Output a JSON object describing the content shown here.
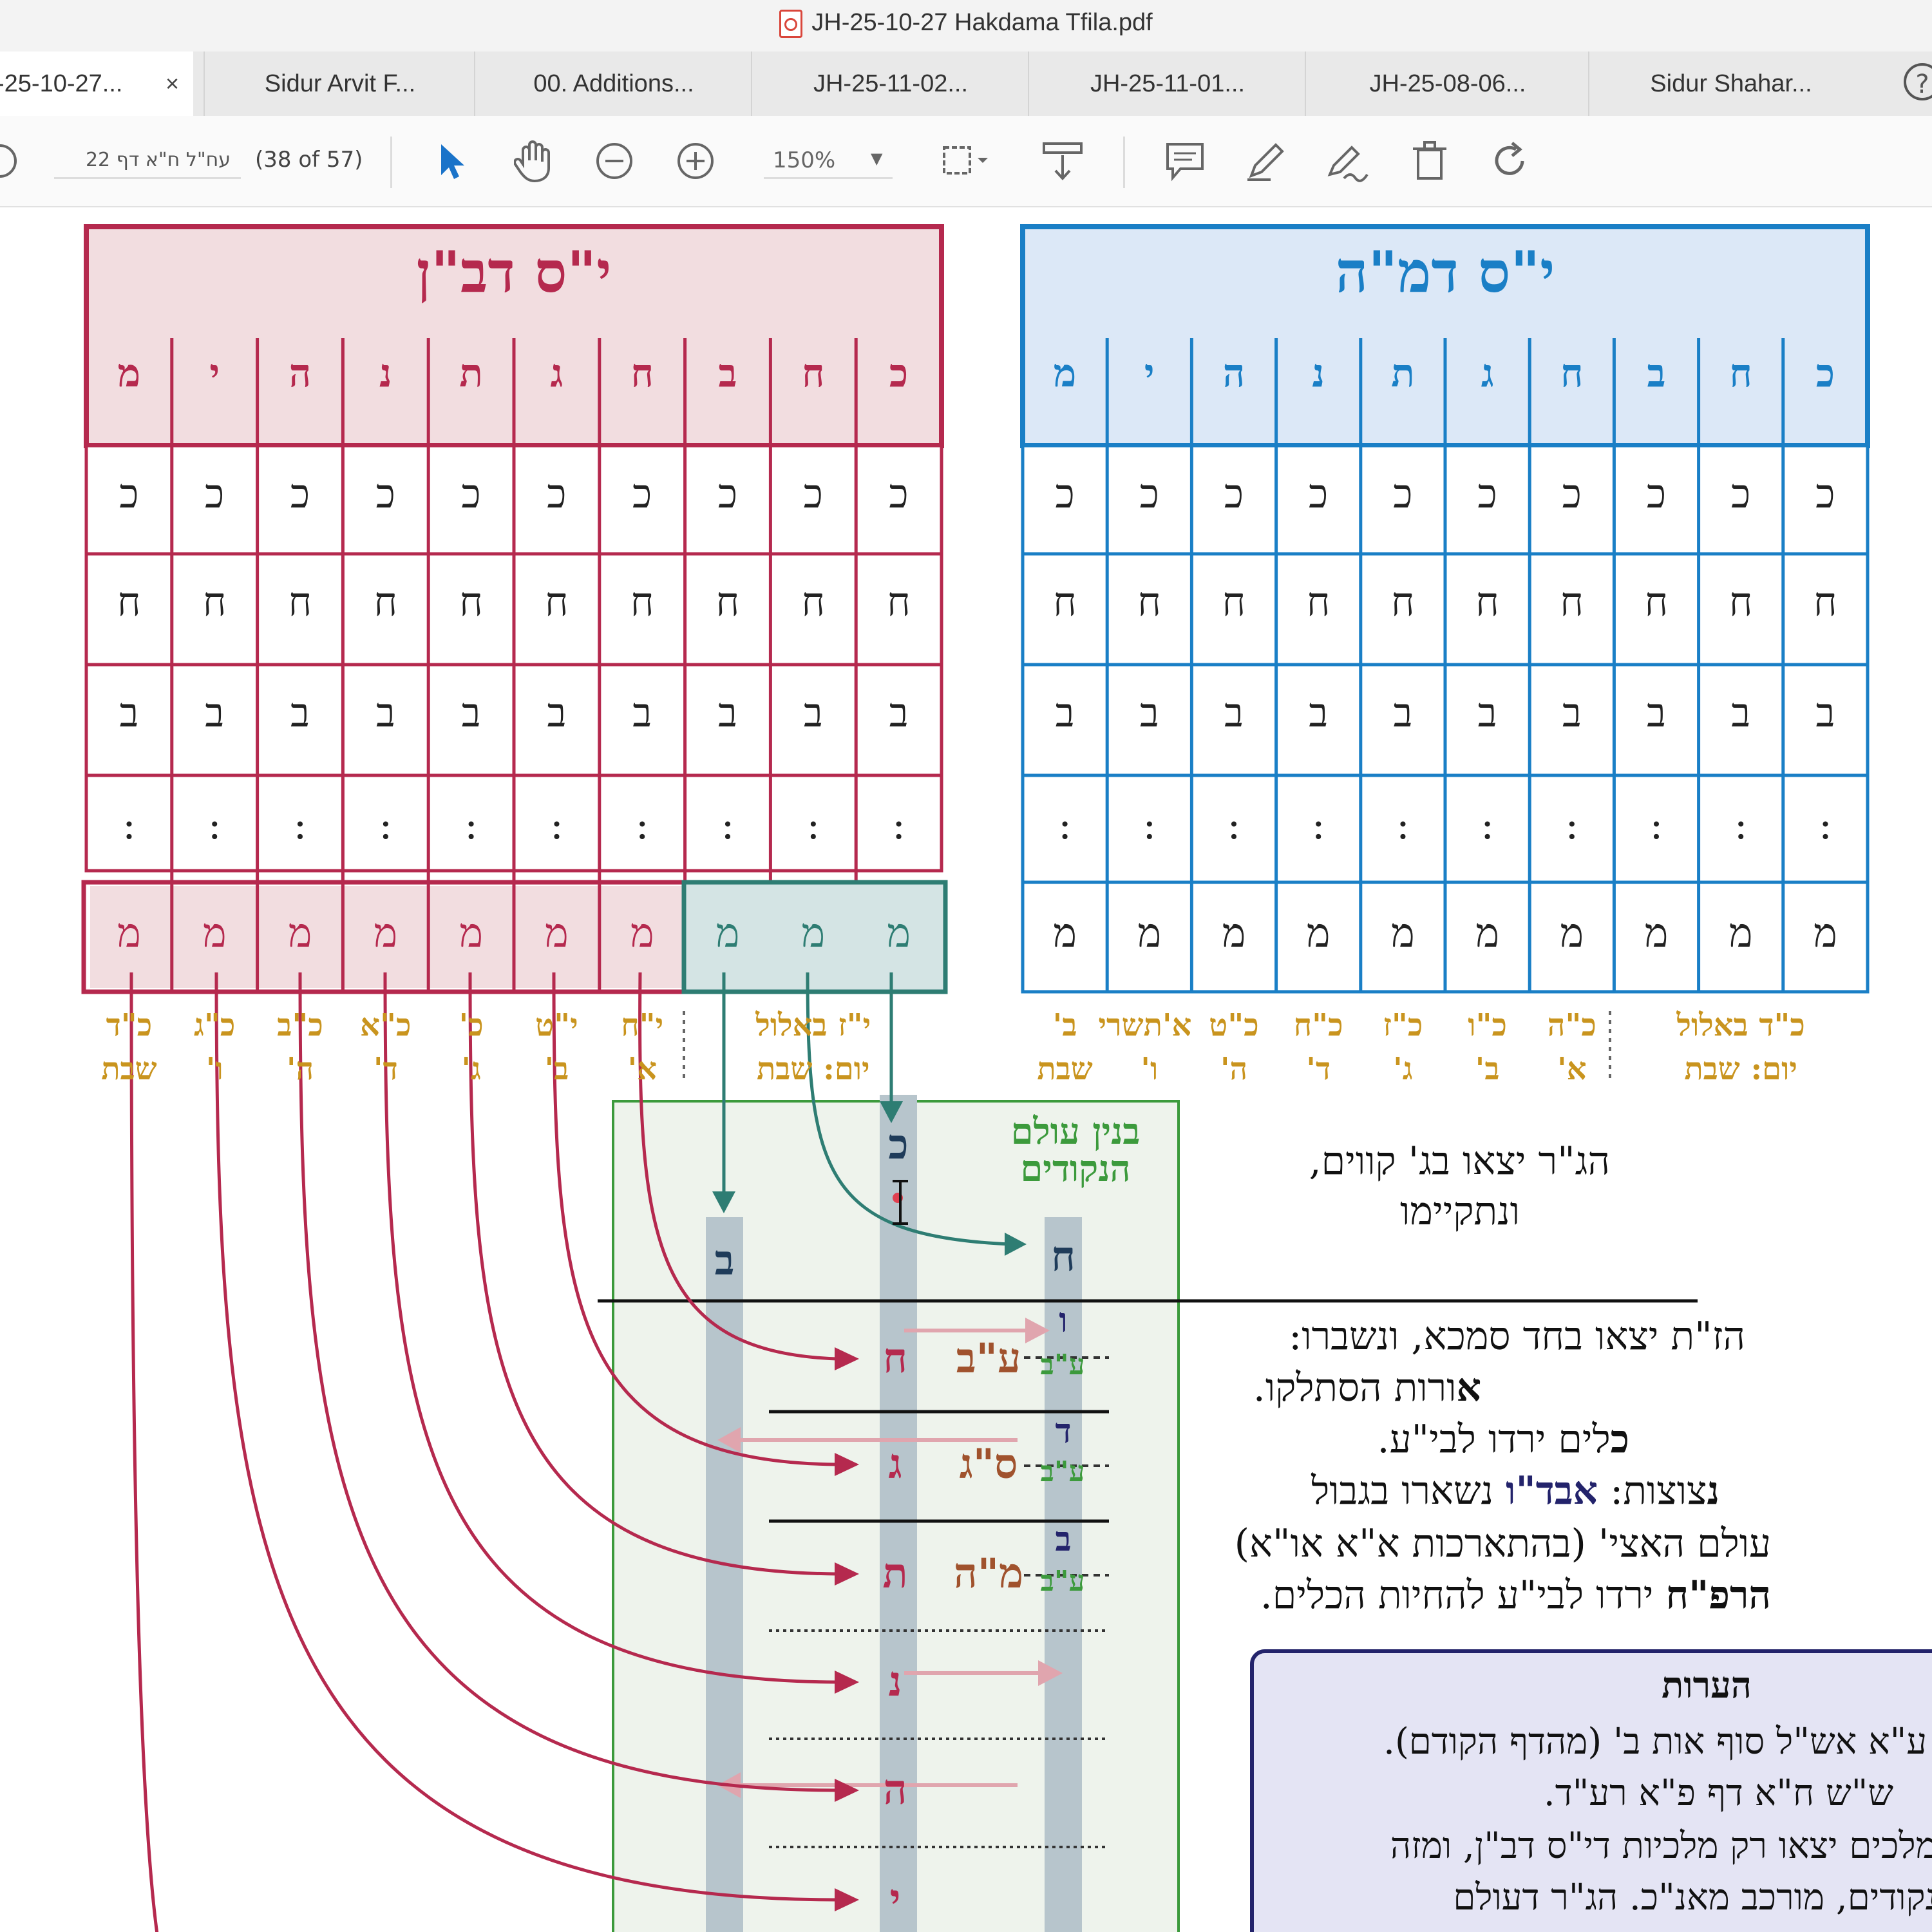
{
  "window": {
    "title": "JH-25-10-27 Hakdama Tfila.pdf"
  },
  "tabs": [
    {
      "label": "-25-10-27...",
      "close": "×"
    },
    {
      "label": "Sidur Arvit F..."
    },
    {
      "label": "00. Additions..."
    },
    {
      "label": "JH-25-11-02..."
    },
    {
      "label": "JH-25-11-01..."
    },
    {
      "label": "JH-25-08-06..."
    },
    {
      "label": "Sidur Shahar..."
    }
  ],
  "toolbar": {
    "page_field": "עח\"ל ח\"א דף 22",
    "page_count": "(38 of 57)",
    "zoom": "150%",
    "help": "?"
  },
  "colors": {
    "red": "#b5294e",
    "red_fill": "#f2dde0",
    "blue": "#1a7fc6",
    "blue_fill": "#dce8f7",
    "teal": "#2e7d73",
    "gold": "#c9941e",
    "green": "#3c9a3c"
  },
  "panels": {
    "left_title": "י\"ס דב\"ן",
    "right_title": "י\"ס דמ\"ה",
    "header_letters": [
      "כ",
      "ח",
      "ב",
      "ח",
      "ג",
      "ת",
      "נ",
      "ה",
      "י",
      "מ"
    ],
    "rows": [
      [
        "כ",
        "כ",
        "כ",
        "כ",
        "כ",
        "כ",
        "כ",
        "כ",
        "כ",
        "כ"
      ],
      [
        "ח",
        "ח",
        "ח",
        "ח",
        "ח",
        "ח",
        "ח",
        "ח",
        "ח",
        "ח"
      ],
      [
        "ב",
        "ב",
        "ב",
        "ב",
        "ב",
        "ב",
        "ב",
        "ב",
        "ב",
        "ב"
      ],
      [
        ":",
        ":",
        ":",
        ":",
        ":",
        ":",
        ":",
        ":",
        ":",
        ":"
      ]
    ],
    "bottom_row": [
      "מ",
      "מ",
      "מ",
      "מ",
      "מ",
      "מ",
      "מ",
      "מ",
      "מ",
      "מ"
    ]
  },
  "date_labels": {
    "left": [
      [
        "י\"ז באלול",
        "יום: שבת"
      ],
      [
        "י\"ח",
        "א'"
      ],
      [
        "י\"ט",
        "ב'"
      ],
      [
        "כ'",
        "ג'"
      ],
      [
        "כ\"א",
        "ד'"
      ],
      [
        "כ\"ב",
        "ה'"
      ],
      [
        "כ\"ג",
        "ו'"
      ],
      [
        "כ\"ד",
        "שבת"
      ]
    ],
    "right": [
      [
        "כ\"ד באלול",
        "יום: שבת"
      ],
      [
        "כ\"ה",
        "א'"
      ],
      [
        "כ\"ו",
        "ב'"
      ],
      [
        "כ\"ז",
        "ג'"
      ],
      [
        "כ\"ח",
        "ד'"
      ],
      [
        "כ\"ט",
        "ה'"
      ],
      [
        "א'תשרי",
        "ו'"
      ],
      [
        "ב'",
        "שבת"
      ]
    ]
  },
  "center": {
    "title_l1": "בנין עולם",
    "title_l2": "הנקודים",
    "top_letters": [
      "ב",
      "כ",
      "ח"
    ],
    "right_column": [
      "ו",
      "ע\"ב",
      "ד",
      "ע\"ב",
      "ב",
      "ע\"ב"
    ],
    "mid_letters": [
      "ח",
      "ג",
      "ת",
      "נ",
      "ה",
      "י"
    ],
    "names": [
      "ע\"ב",
      "ס\"ג",
      "מ\"ה"
    ]
  },
  "notes": {
    "line1": "הג\"ר יצאו בג' קווים,",
    "line2": "ונתקיימו",
    "line3": "הז\"ת יצאו בחד סמכא, ונשברו:",
    "line4_bold": "א",
    "line4": "ורות הסתלקו.",
    "line5_bold": "כ",
    "line5": "לים ירדו לבי\"ע.",
    "line6_bold": "נ",
    "line6a": "צוצות: ",
    "line6_blue": "אבד\"ו",
    "line6b": " נשארו בגבול",
    "line7": "עולם האצי' (בהתארכות א\"א או\"א)",
    "line8_bold": "הרפ\"ח",
    "line8_green": "רפ\"ח",
    "line8": " ירדו לבי\"ע להחיות הכלים."
  },
  "remarks": {
    "title": "הערות",
    "line1": "י' ע\"א אש\"ל סוף אות ב' (מהדף הקודם).",
    "line2": "ש\"ש ח\"א דף פ\"א רע\"ד.",
    "line3": "המלכים יצאו רק מלכיות די\"ס דב\"ן, ומזה",
    "line4": "הנקודים, מורכב מאנ\"כ. הג\"ר דעולם"
  }
}
